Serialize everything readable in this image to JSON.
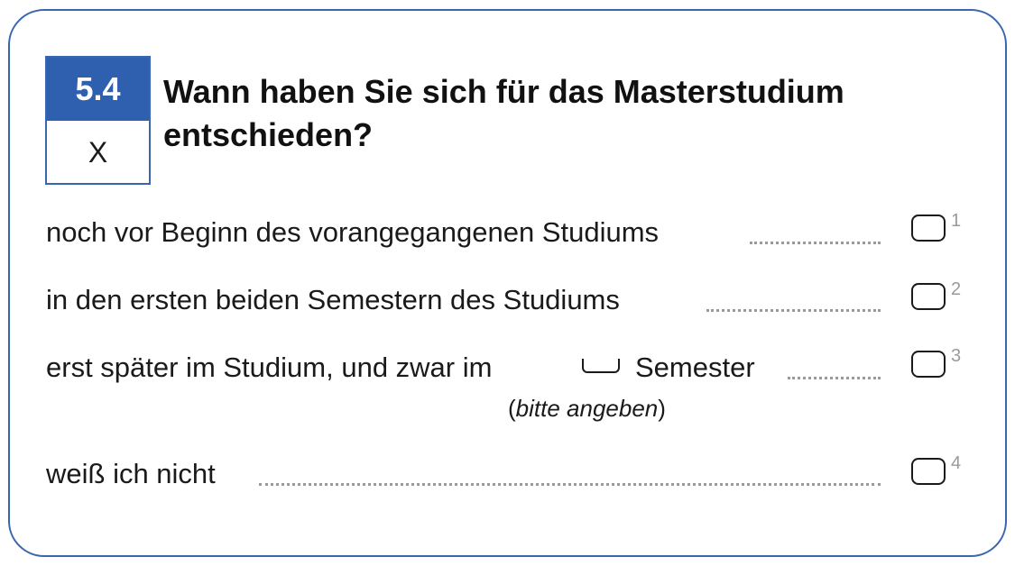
{
  "question": {
    "number": "5.4",
    "code": "X",
    "text": "Wann haben Sie sich für das Masterstudium entschieden?"
  },
  "options": [
    {
      "label": "noch vor Beginn des vorangegangenen Studiums",
      "code": "1"
    },
    {
      "label": "in den ersten beiden Semestern des Studiums",
      "code": "2"
    },
    {
      "label_before": "erst später im Studium, und zwar im",
      "label_after": "Semester",
      "code": "3",
      "hint_open": "(",
      "hint_text": "bitte angeben",
      "hint_close": ")"
    },
    {
      "label": "weiß ich nicht",
      "code": "4"
    }
  ]
}
